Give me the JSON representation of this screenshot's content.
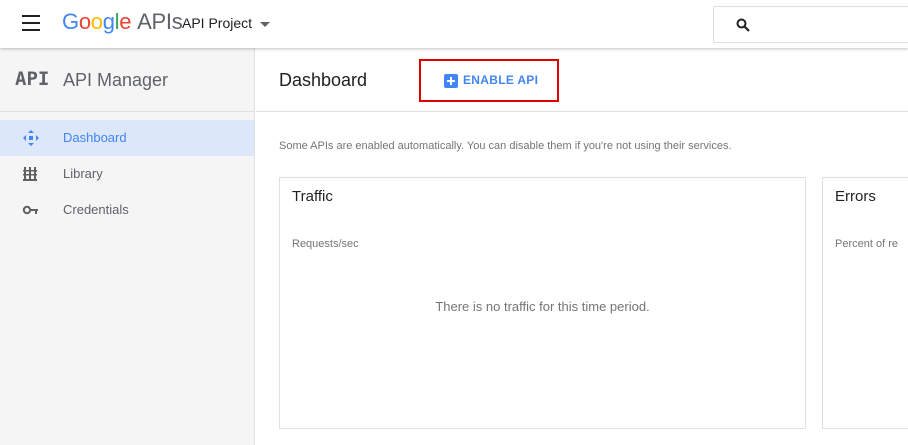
{
  "topbar": {
    "brand_google": [
      "G",
      "o",
      "o",
      "g",
      "l",
      "e"
    ],
    "brand_apis": "APIs",
    "project_name": "API Project",
    "search_placeholder": ""
  },
  "sidebar": {
    "logo_text": "API",
    "title": "API Manager",
    "items": [
      {
        "label": "Dashboard",
        "icon": "dashboard-icon",
        "active": true
      },
      {
        "label": "Library",
        "icon": "library-icon",
        "active": false
      },
      {
        "label": "Credentials",
        "icon": "key-icon",
        "active": false
      }
    ]
  },
  "header": {
    "title": "Dashboard",
    "enable_api_label": "ENABLE API"
  },
  "main": {
    "notice": "Some APIs are enabled automatically. You can disable them if you're not using their services.",
    "cards": [
      {
        "title": "Traffic",
        "subtitle": "Requests/sec",
        "empty_message": "There is no traffic for this time period."
      },
      {
        "title": "Errors",
        "subtitle": "Percent of re"
      }
    ]
  },
  "colors": {
    "accent": "#4285f4",
    "highlight_border": "#e00000",
    "sidebar_active_bg": "#dce7f9"
  }
}
